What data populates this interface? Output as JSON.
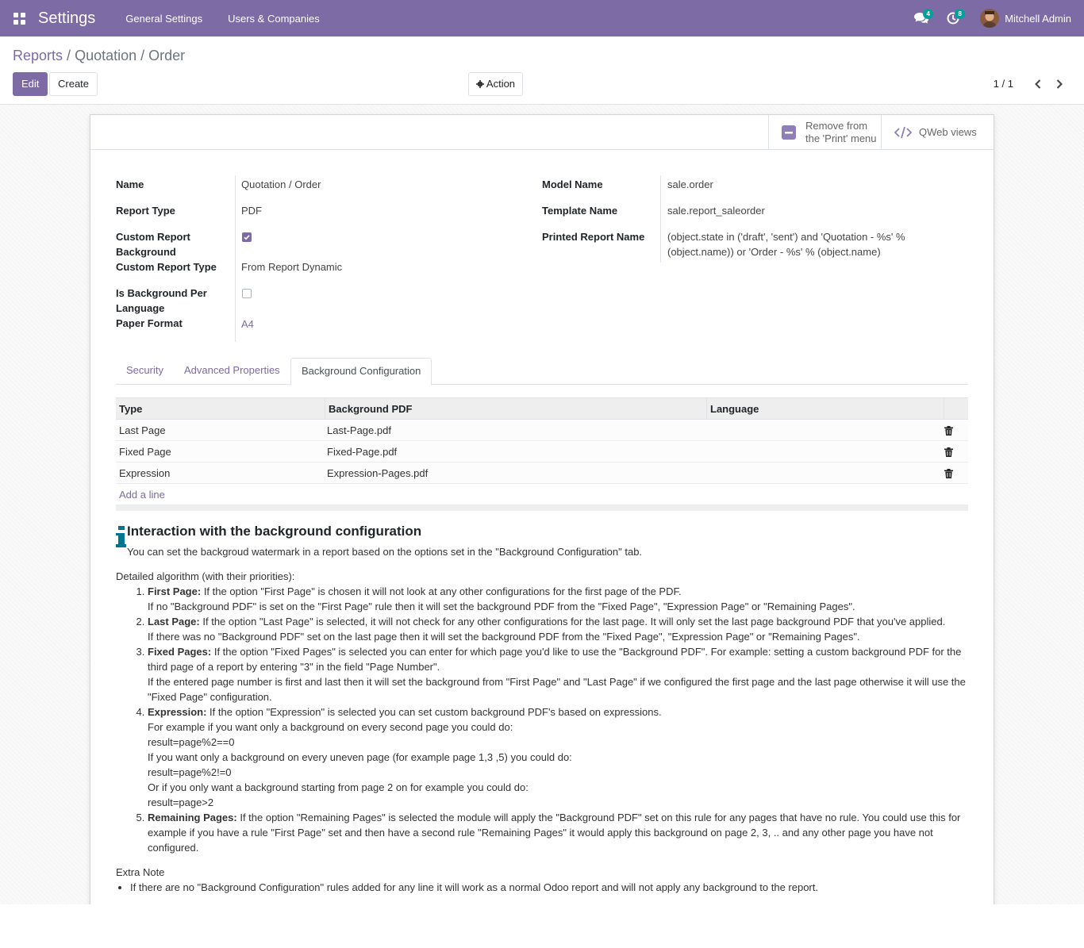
{
  "navbar": {
    "brand": "Settings",
    "menu": [
      "General Settings",
      "Users & Companies"
    ],
    "messages_badge": "4",
    "activities_badge": "8",
    "user_name": "Mitchell Admin"
  },
  "breadcrumb": {
    "parent": "Reports",
    "separator": "/",
    "current": "Quotation / Order"
  },
  "toolbar": {
    "edit_label": "Edit",
    "create_label": "Create",
    "action_label": "Action",
    "pager": "1 / 1"
  },
  "button_box": {
    "remove_print_label": "Remove from the 'Print' menu",
    "qweb_label": "QWeb views"
  },
  "fields": {
    "name_label": "Name",
    "name_value": "Quotation / Order",
    "report_type_label": "Report Type",
    "report_type_value": "PDF",
    "custom_bg_label": "Custom Report Background",
    "custom_bg_checked": true,
    "custom_type_label": "Custom Report Type",
    "custom_type_value": "From Report Dynamic",
    "bg_per_lang_label": "Is Background Per Language",
    "bg_per_lang_checked": false,
    "paper_format_label": "Paper Format",
    "paper_format_value": "A4",
    "model_name_label": "Model Name",
    "model_name_value": "sale.order",
    "template_name_label": "Template Name",
    "template_name_value": "sale.report_saleorder",
    "printed_name_label": "Printed Report Name",
    "printed_name_value": "(object.state in ('draft', 'sent') and 'Quotation - %s' % (object.name)) or 'Order - %s' % (object.name)"
  },
  "tabs": [
    "Security",
    "Advanced Properties",
    "Background Configuration"
  ],
  "table": {
    "headers": [
      "Type",
      "Background PDF",
      "Language"
    ],
    "rows": [
      {
        "type": "Last Page",
        "pdf": "Last-Page.pdf",
        "language": ""
      },
      {
        "type": "Fixed Page",
        "pdf": "Fixed-Page.pdf",
        "language": ""
      },
      {
        "type": "Expression",
        "pdf": "Expression-Pages.pdf",
        "language": ""
      }
    ],
    "add_line": "Add a line"
  },
  "info": {
    "title": "Interaction with the background configuration",
    "subtitle": "You can set the backgroud watermark in a report based on the options set in the \"Background Configuration\" tab.",
    "algo_intro": "Detailed algorithm (with their priorities):",
    "items": [
      {
        "head": "First Page:",
        "lines": [
          "If the option \"First Page\" is chosen it will not look at any other configurations for the first page of the PDF.",
          "If no \"Background PDF\" is set on the \"First Page\" rule then it will set the background PDF from the \"Fixed Page\", \"Expression Page\" or \"Remaining Pages\"."
        ]
      },
      {
        "head": "Last Page:",
        "lines": [
          "If the option \"Last Page\" is selected, it will not check for any other configurations for the last page. It will only set the last page background PDF that you've applied.",
          "If there was no \"Background PDF\" set on the last page then it will set the background PDF from the \"Fixed Page\", \"Expression Page\" or \"Remaining Pages\"."
        ]
      },
      {
        "head": "Fixed Pages:",
        "lines": [
          "If the option \"Fixed Pages\" is selected you can enter for which page you'd like to use the \"Background PDF\". For example: setting a custom background PDF for the third page of a report by entering \"3\" in the field \"Page Number\".",
          "If the entered page number is first and last then it will set the background from \"First Page\" and \"Last Page\" if we configured the first page and the last page otherwise it will use the \"Fixed Page\" configuration."
        ]
      },
      {
        "head": "Expression:",
        "lines": [
          "If the option \"Expression\" is selected you can set custom background PDF's based on expressions.",
          "For example if you want only a background on every second page you could do:",
          "result=page%2==0",
          "If you want only a background on every uneven page (for example page 1,3 ,5) you could do:",
          "result=page%2!=0",
          "Or if you only want a background starting from page 2 on for example you could do:",
          "result=page>2"
        ]
      },
      {
        "head": "Remaining Pages:",
        "lines": [
          "If the option \"Remaining Pages\" is selected the module will apply the \"Background PDF\" set on this rule for any pages that have no rule. You could use this for example if you have a rule \"First Page\" set and then have a second rule \"Remaining Pages\" it would apply this background on page 2, 3, .. and any other page you have not configured."
        ]
      }
    ],
    "extra_note_title": "Extra Note",
    "extra_note": "If there are no \"Background Configuration\" rules added for any line it will work as a normal Odoo report and will not apply any background to the report."
  },
  "colors": {
    "brand": "#7c6ba4",
    "badge": "#00a09d",
    "info_icon": "#00758f"
  }
}
